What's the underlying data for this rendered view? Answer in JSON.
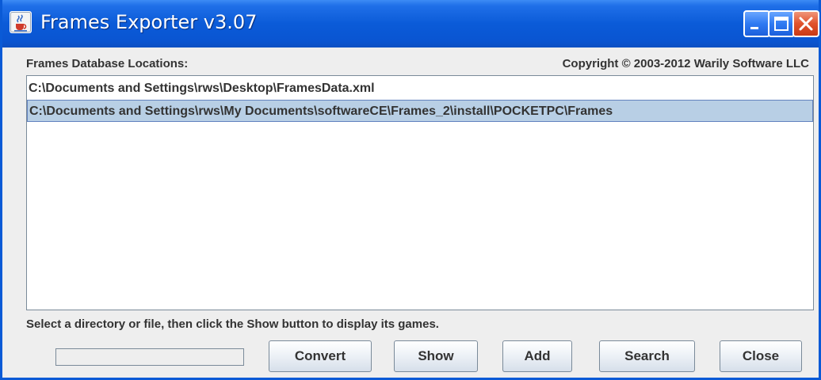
{
  "window": {
    "title": "Frames Exporter v3.07"
  },
  "header": {
    "locations_label": "Frames Database Locations:",
    "copyright": "Copyright © 2003-2012 Warily Software LLC"
  },
  "locations": [
    {
      "path": "C:\\Documents and Settings\\rws\\Desktop\\FramesData.xml",
      "selected": false
    },
    {
      "path": "C:\\Documents and Settings\\rws\\My Documents\\softwareCE\\Frames_2\\install\\POCKETPC\\Frames",
      "selected": true
    }
  ],
  "instruction": "Select a directory or file, then click the Show button to display its games.",
  "progress": {
    "fraction": 0
  },
  "buttons": {
    "convert": "Convert",
    "show": "Show",
    "add": "Add",
    "search": "Search",
    "close": "Close"
  },
  "colors": {
    "title_bar": "#0a55d2",
    "selection": "#b8cfe5",
    "selection_border": "#6382bf",
    "panel": "#eeeeee",
    "text": "#333333"
  },
  "icons": {
    "app": "java-coffee-cup-icon",
    "minimize": "minimize-icon",
    "maximize": "maximize-icon",
    "close": "close-icon"
  }
}
